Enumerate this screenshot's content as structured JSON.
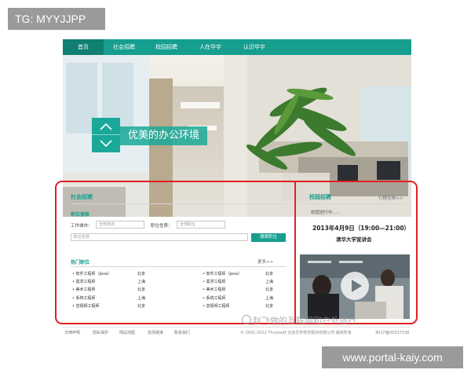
{
  "overlay": {
    "top_tag": "TG: MYYJJPP",
    "bottom_tag": "www.portal-kaiy.com",
    "watermark": "赵飞做的互联网和户外旅行"
  },
  "nav": {
    "items": [
      {
        "label": "首页",
        "active": true
      },
      {
        "label": "社会招聘",
        "active": false
      },
      {
        "label": "校园招聘",
        "active": false
      },
      {
        "label": "人在华宇",
        "active": false
      },
      {
        "label": "认识华宇",
        "active": false
      }
    ]
  },
  "banner": {
    "caption": "优美的办公环境"
  },
  "social": {
    "title": "社会招聘",
    "search_title": "职位搜索",
    "city_label": "工作城市：",
    "city_placeholder": "全部地点",
    "type_label": "职位性质：",
    "type_placeholder": "全部职位",
    "name_placeholder": "职位名称",
    "search_button": "搜索职位",
    "hot_title": "热门职位",
    "more": "更多>>",
    "jobs_left": [
      {
        "title": "• 软件工程师（Java）",
        "city": "北京"
      },
      {
        "title": "• 需求工程师",
        "city": "上海"
      },
      {
        "title": "• 美术工程师",
        "city": "北京"
      },
      {
        "title": "• 系统工程师",
        "city": "上海"
      },
      {
        "title": "• 音视频工程师",
        "city": "北京"
      }
    ],
    "jobs_right": [
      {
        "title": "• 软件工程师（Java）",
        "city": "北京"
      },
      {
        "title": "• 需求工程师",
        "city": "上海"
      },
      {
        "title": "• 美术工程师",
        "city": "北京"
      },
      {
        "title": "• 系统工程师",
        "city": "上海"
      },
      {
        "title": "• 音视频工程师",
        "city": "北京"
      }
    ]
  },
  "campus": {
    "title": "校园招聘",
    "schedule_link": "行程安排>>",
    "status": "校园进行中......",
    "date": "2013年4月9日（19:00—21:00）",
    "venue": "清华大学宣讲会"
  },
  "footer": {
    "links": [
      "法律声明",
      "隐私保护",
      "网站地图",
      "友情链接",
      "联系我们"
    ],
    "copyright": "© 2001-2012 Thunisoft 北京华宇软件股份有限公司 版权所有",
    "icp": "京ICP备05037336"
  },
  "colors": {
    "brand": "#169e8f",
    "frame": "#e02020"
  }
}
